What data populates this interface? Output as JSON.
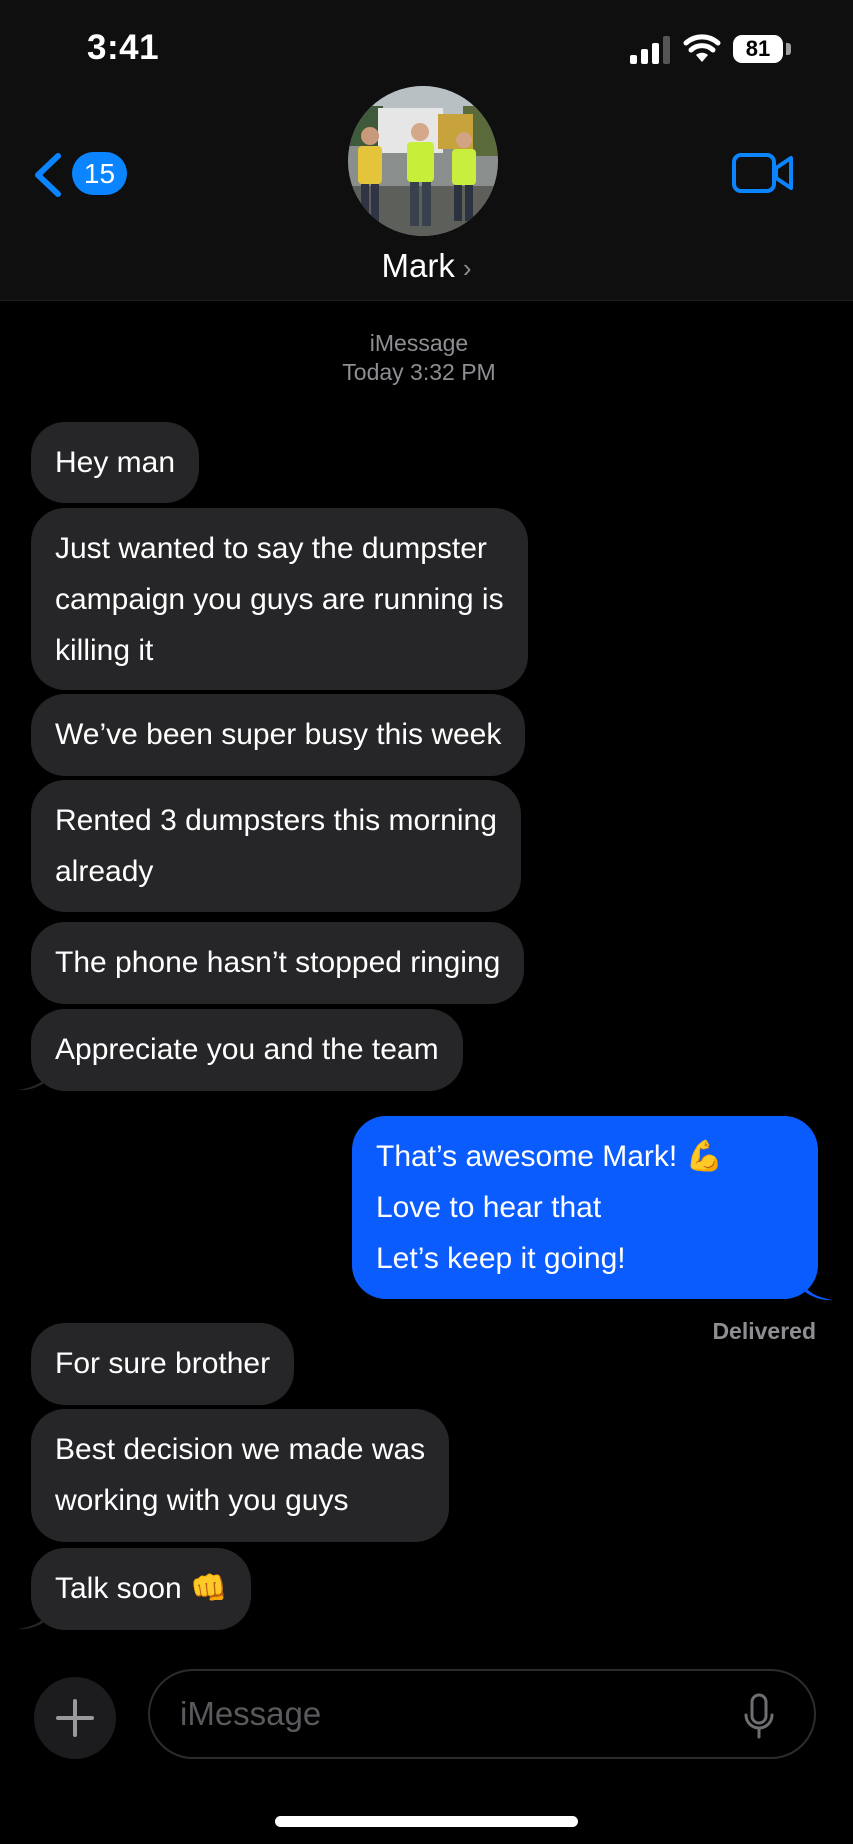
{
  "status_bar": {
    "time": "3:41",
    "battery": "81"
  },
  "nav": {
    "unread_count": "15",
    "contact_name": "Mark"
  },
  "conversation": {
    "service": "iMessage",
    "timestamp": "Today 3:32 PM",
    "messages": [
      {
        "from": "them",
        "lines": [
          "Hey man"
        ]
      },
      {
        "from": "them",
        "lines": [
          "Just wanted to say the dumpster",
          "campaign you guys are running is",
          "killing it"
        ]
      },
      {
        "from": "them",
        "lines": [
          "We’ve been super busy this week"
        ]
      },
      {
        "from": "them",
        "lines": [
          "Rented 3 dumpsters this morning",
          "already"
        ]
      },
      {
        "from": "them",
        "lines": [
          "The phone hasn’t stopped ringing"
        ]
      },
      {
        "from": "them",
        "lines": [
          "Appreciate you and the team"
        ]
      },
      {
        "from": "me",
        "lines": [
          "That’s awesome Mark! 💪",
          "Love to hear that",
          "Let’s keep it going!"
        ]
      },
      {
        "from": "them",
        "lines": [
          "For sure brother"
        ]
      },
      {
        "from": "them",
        "lines": [
          "Best decision we made was",
          "working with you guys"
        ]
      },
      {
        "from": "them",
        "lines": [
          "Talk soon 👊"
        ]
      }
    ],
    "delivered_label": "Delivered"
  },
  "composer": {
    "placeholder": "iMessage"
  },
  "colors": {
    "sent_bubble": "#0a5cff",
    "received_bubble": "#262628",
    "accent": "#0a84ff"
  },
  "icons": [
    "signal-icon",
    "wifi-icon",
    "chevron-left-icon",
    "video-camera-icon",
    "plus-icon",
    "microphone-icon"
  ]
}
